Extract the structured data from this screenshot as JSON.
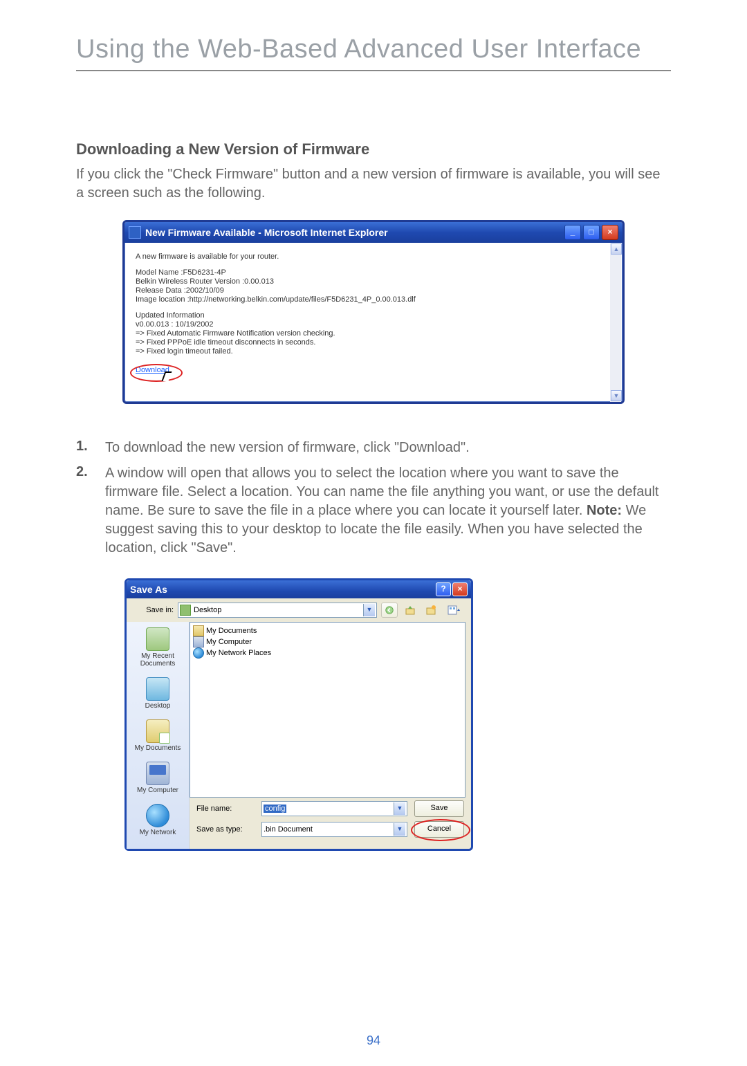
{
  "chapter_title": "Using the Web-Based Advanced User Interface",
  "section_heading": "Downloading a New Version of Firmware",
  "intro_text": "If you click the \"Check Firmware\" button and a new version of firmware is available, you will see a screen such as the following.",
  "ie_popup": {
    "title": "New Firmware Available - Microsoft Internet Explorer",
    "min_label": "_",
    "max_label": "□",
    "close_label": "×",
    "line_intro": "A new firmware is available for your router.",
    "line_model": "Model Name :F5D6231-4P",
    "line_version": "Belkin Wireless Router Version :0.00.013",
    "line_release": "Release Data :2002/10/09",
    "line_location": "Image location :http://networking.belkin.com/update/files/F5D6231_4P_0.00.013.dlf",
    "line_up1": "Updated Information",
    "line_up2": "v0.00.013 : 10/19/2002",
    "line_up3": "=> Fixed Automatic Firmware Notification version checking.",
    "line_up4": "=> Fixed PPPoE idle timeout disconnects in seconds.",
    "line_up5": "=> Fixed login timeout failed.",
    "download": "Download"
  },
  "steps": {
    "step1_num": "1.",
    "step1_text": "To download the new version of firmware, click \"Download\".",
    "step2_num": "2.",
    "step2_text_a": "A window will open that allows you to select the location where you want to save the firmware file. Select a location. You can name the file anything you want, or use the default name. Be sure to save the file in a place where you can locate it yourself later. ",
    "step2_note_label": "Note:",
    "step2_text_b": " We suggest saving this to your desktop to locate the file easily. When you have selected the location, click \"Save\"."
  },
  "saveas": {
    "title": "Save As",
    "help": "?",
    "close": "×",
    "savein_label": "Save in:",
    "savein_value": "Desktop",
    "places": {
      "recent": "My Recent Documents",
      "desktop": "Desktop",
      "docs": "My Documents",
      "comp": "My Computer",
      "net": "My Network"
    },
    "filelist": {
      "f1": "My Documents",
      "f2": "My Computer",
      "f3": "My Network Places"
    },
    "filename_label": "File name:",
    "filename_value": "config",
    "type_label": "Save as type:",
    "type_value": ".bin Document",
    "save_btn": "Save",
    "cancel_btn": "Cancel"
  },
  "page_number": "94"
}
